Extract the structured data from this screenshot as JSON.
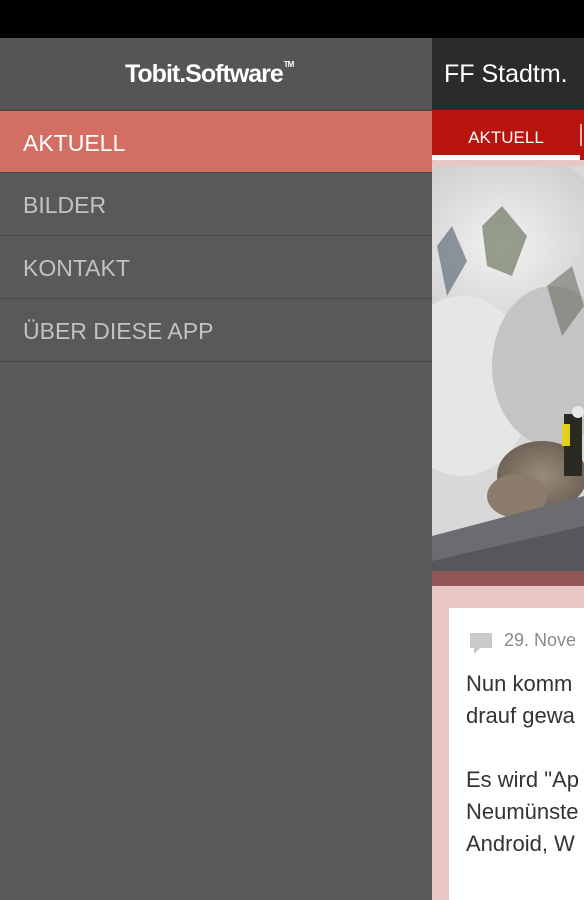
{
  "app_bar": {
    "title": "FF Stadtm."
  },
  "tabs": [
    {
      "label": "AKTUELL",
      "active": true
    }
  ],
  "post": {
    "date": "29. Nove",
    "text": "Nun komm\ndrauf gewa\n\nEs wird \"Ap\nNeumünste\nAndroid, W",
    "ellipsis": "..."
  },
  "drawer": {
    "brand": "Tobit.Software",
    "brand_mark": "TM",
    "items": [
      {
        "label": "AKTUELL",
        "active": true
      },
      {
        "label": "BILDER"
      },
      {
        "label": "KONTAKT"
      },
      {
        "label": "ÜBER DIESE APP"
      }
    ]
  },
  "colors": {
    "drawer_bg": "#595959",
    "active_item": "#d36e63",
    "tab_bar": "#b8140e",
    "app_bar": "#2b2b2b",
    "content_bg": "#e8c6c2"
  },
  "icons": {
    "comment": "comment-icon"
  }
}
